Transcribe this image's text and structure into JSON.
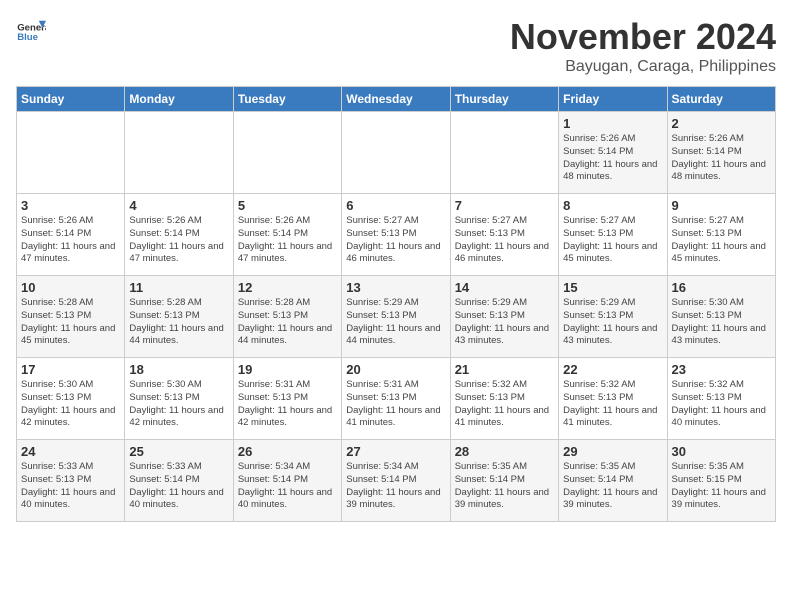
{
  "header": {
    "logo_line1": "General",
    "logo_line2": "Blue",
    "month": "November 2024",
    "location": "Bayugan, Caraga, Philippines"
  },
  "weekdays": [
    "Sunday",
    "Monday",
    "Tuesday",
    "Wednesday",
    "Thursday",
    "Friday",
    "Saturday"
  ],
  "weeks": [
    [
      {
        "day": "",
        "sunrise": "",
        "sunset": "",
        "daylight": ""
      },
      {
        "day": "",
        "sunrise": "",
        "sunset": "",
        "daylight": ""
      },
      {
        "day": "",
        "sunrise": "",
        "sunset": "",
        "daylight": ""
      },
      {
        "day": "",
        "sunrise": "",
        "sunset": "",
        "daylight": ""
      },
      {
        "day": "",
        "sunrise": "",
        "sunset": "",
        "daylight": ""
      },
      {
        "day": "1",
        "sunrise": "Sunrise: 5:26 AM",
        "sunset": "Sunset: 5:14 PM",
        "daylight": "Daylight: 11 hours and 48 minutes."
      },
      {
        "day": "2",
        "sunrise": "Sunrise: 5:26 AM",
        "sunset": "Sunset: 5:14 PM",
        "daylight": "Daylight: 11 hours and 48 minutes."
      }
    ],
    [
      {
        "day": "3",
        "sunrise": "Sunrise: 5:26 AM",
        "sunset": "Sunset: 5:14 PM",
        "daylight": "Daylight: 11 hours and 47 minutes."
      },
      {
        "day": "4",
        "sunrise": "Sunrise: 5:26 AM",
        "sunset": "Sunset: 5:14 PM",
        "daylight": "Daylight: 11 hours and 47 minutes."
      },
      {
        "day": "5",
        "sunrise": "Sunrise: 5:26 AM",
        "sunset": "Sunset: 5:14 PM",
        "daylight": "Daylight: 11 hours and 47 minutes."
      },
      {
        "day": "6",
        "sunrise": "Sunrise: 5:27 AM",
        "sunset": "Sunset: 5:13 PM",
        "daylight": "Daylight: 11 hours and 46 minutes."
      },
      {
        "day": "7",
        "sunrise": "Sunrise: 5:27 AM",
        "sunset": "Sunset: 5:13 PM",
        "daylight": "Daylight: 11 hours and 46 minutes."
      },
      {
        "day": "8",
        "sunrise": "Sunrise: 5:27 AM",
        "sunset": "Sunset: 5:13 PM",
        "daylight": "Daylight: 11 hours and 45 minutes."
      },
      {
        "day": "9",
        "sunrise": "Sunrise: 5:27 AM",
        "sunset": "Sunset: 5:13 PM",
        "daylight": "Daylight: 11 hours and 45 minutes."
      }
    ],
    [
      {
        "day": "10",
        "sunrise": "Sunrise: 5:28 AM",
        "sunset": "Sunset: 5:13 PM",
        "daylight": "Daylight: 11 hours and 45 minutes."
      },
      {
        "day": "11",
        "sunrise": "Sunrise: 5:28 AM",
        "sunset": "Sunset: 5:13 PM",
        "daylight": "Daylight: 11 hours and 44 minutes."
      },
      {
        "day": "12",
        "sunrise": "Sunrise: 5:28 AM",
        "sunset": "Sunset: 5:13 PM",
        "daylight": "Daylight: 11 hours and 44 minutes."
      },
      {
        "day": "13",
        "sunrise": "Sunrise: 5:29 AM",
        "sunset": "Sunset: 5:13 PM",
        "daylight": "Daylight: 11 hours and 44 minutes."
      },
      {
        "day": "14",
        "sunrise": "Sunrise: 5:29 AM",
        "sunset": "Sunset: 5:13 PM",
        "daylight": "Daylight: 11 hours and 43 minutes."
      },
      {
        "day": "15",
        "sunrise": "Sunrise: 5:29 AM",
        "sunset": "Sunset: 5:13 PM",
        "daylight": "Daylight: 11 hours and 43 minutes."
      },
      {
        "day": "16",
        "sunrise": "Sunrise: 5:30 AM",
        "sunset": "Sunset: 5:13 PM",
        "daylight": "Daylight: 11 hours and 43 minutes."
      }
    ],
    [
      {
        "day": "17",
        "sunrise": "Sunrise: 5:30 AM",
        "sunset": "Sunset: 5:13 PM",
        "daylight": "Daylight: 11 hours and 42 minutes."
      },
      {
        "day": "18",
        "sunrise": "Sunrise: 5:30 AM",
        "sunset": "Sunset: 5:13 PM",
        "daylight": "Daylight: 11 hours and 42 minutes."
      },
      {
        "day": "19",
        "sunrise": "Sunrise: 5:31 AM",
        "sunset": "Sunset: 5:13 PM",
        "daylight": "Daylight: 11 hours and 42 minutes."
      },
      {
        "day": "20",
        "sunrise": "Sunrise: 5:31 AM",
        "sunset": "Sunset: 5:13 PM",
        "daylight": "Daylight: 11 hours and 41 minutes."
      },
      {
        "day": "21",
        "sunrise": "Sunrise: 5:32 AM",
        "sunset": "Sunset: 5:13 PM",
        "daylight": "Daylight: 11 hours and 41 minutes."
      },
      {
        "day": "22",
        "sunrise": "Sunrise: 5:32 AM",
        "sunset": "Sunset: 5:13 PM",
        "daylight": "Daylight: 11 hours and 41 minutes."
      },
      {
        "day": "23",
        "sunrise": "Sunrise: 5:32 AM",
        "sunset": "Sunset: 5:13 PM",
        "daylight": "Daylight: 11 hours and 40 minutes."
      }
    ],
    [
      {
        "day": "24",
        "sunrise": "Sunrise: 5:33 AM",
        "sunset": "Sunset: 5:13 PM",
        "daylight": "Daylight: 11 hours and 40 minutes."
      },
      {
        "day": "25",
        "sunrise": "Sunrise: 5:33 AM",
        "sunset": "Sunset: 5:14 PM",
        "daylight": "Daylight: 11 hours and 40 minutes."
      },
      {
        "day": "26",
        "sunrise": "Sunrise: 5:34 AM",
        "sunset": "Sunset: 5:14 PM",
        "daylight": "Daylight: 11 hours and 40 minutes."
      },
      {
        "day": "27",
        "sunrise": "Sunrise: 5:34 AM",
        "sunset": "Sunset: 5:14 PM",
        "daylight": "Daylight: 11 hours and 39 minutes."
      },
      {
        "day": "28",
        "sunrise": "Sunrise: 5:35 AM",
        "sunset": "Sunset: 5:14 PM",
        "daylight": "Daylight: 11 hours and 39 minutes."
      },
      {
        "day": "29",
        "sunrise": "Sunrise: 5:35 AM",
        "sunset": "Sunset: 5:14 PM",
        "daylight": "Daylight: 11 hours and 39 minutes."
      },
      {
        "day": "30",
        "sunrise": "Sunrise: 5:35 AM",
        "sunset": "Sunset: 5:15 PM",
        "daylight": "Daylight: 11 hours and 39 minutes."
      }
    ]
  ]
}
